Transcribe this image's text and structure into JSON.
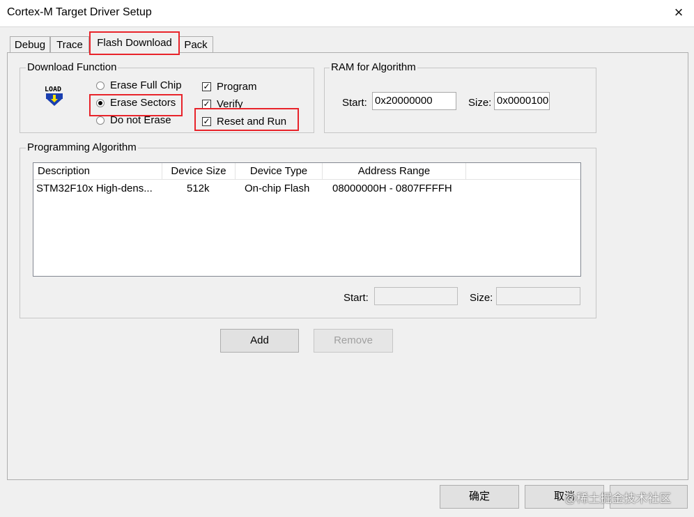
{
  "window": {
    "title": "Cortex-M Target Driver Setup",
    "close_label": "×"
  },
  "tabs": [
    {
      "label": "Debug"
    },
    {
      "label": "Trace"
    },
    {
      "label": "Flash Download"
    },
    {
      "label": "Pack"
    }
  ],
  "active_tab": "Flash Download",
  "download_function": {
    "legend": "Download Function",
    "icon": "load-icon",
    "icon_text": "LOAD",
    "radios": [
      {
        "label": "Erase Full Chip",
        "selected": false
      },
      {
        "label": "Erase Sectors",
        "selected": true
      },
      {
        "label": "Do not Erase",
        "selected": false
      }
    ],
    "checkboxes": [
      {
        "label": "Program",
        "checked": true
      },
      {
        "label": "Verify",
        "checked": true
      },
      {
        "label": "Reset and Run",
        "checked": true
      }
    ]
  },
  "ram": {
    "legend": "RAM for Algorithm",
    "start_label": "Start:",
    "start_value": "0x20000000",
    "size_label": "Size:",
    "size_value": "0x0000100"
  },
  "programming": {
    "legend": "Programming Algorithm",
    "columns": [
      "Description",
      "Device Size",
      "Device Type",
      "Address Range"
    ],
    "rows": [
      {
        "description": "STM32F10x High-dens...",
        "device_size": "512k",
        "device_type": "On-chip Flash",
        "address_range": "08000000H - 0807FFFFH"
      }
    ],
    "start_label": "Start:",
    "start_value": "",
    "size_label": "Size:",
    "size_value": ""
  },
  "buttons": {
    "add": "Add",
    "remove": "Remove",
    "ok": "确定",
    "cancel": "取消"
  },
  "watermark": "@稀土掘金技术社区",
  "colors": {
    "highlight": "#e8232a"
  }
}
